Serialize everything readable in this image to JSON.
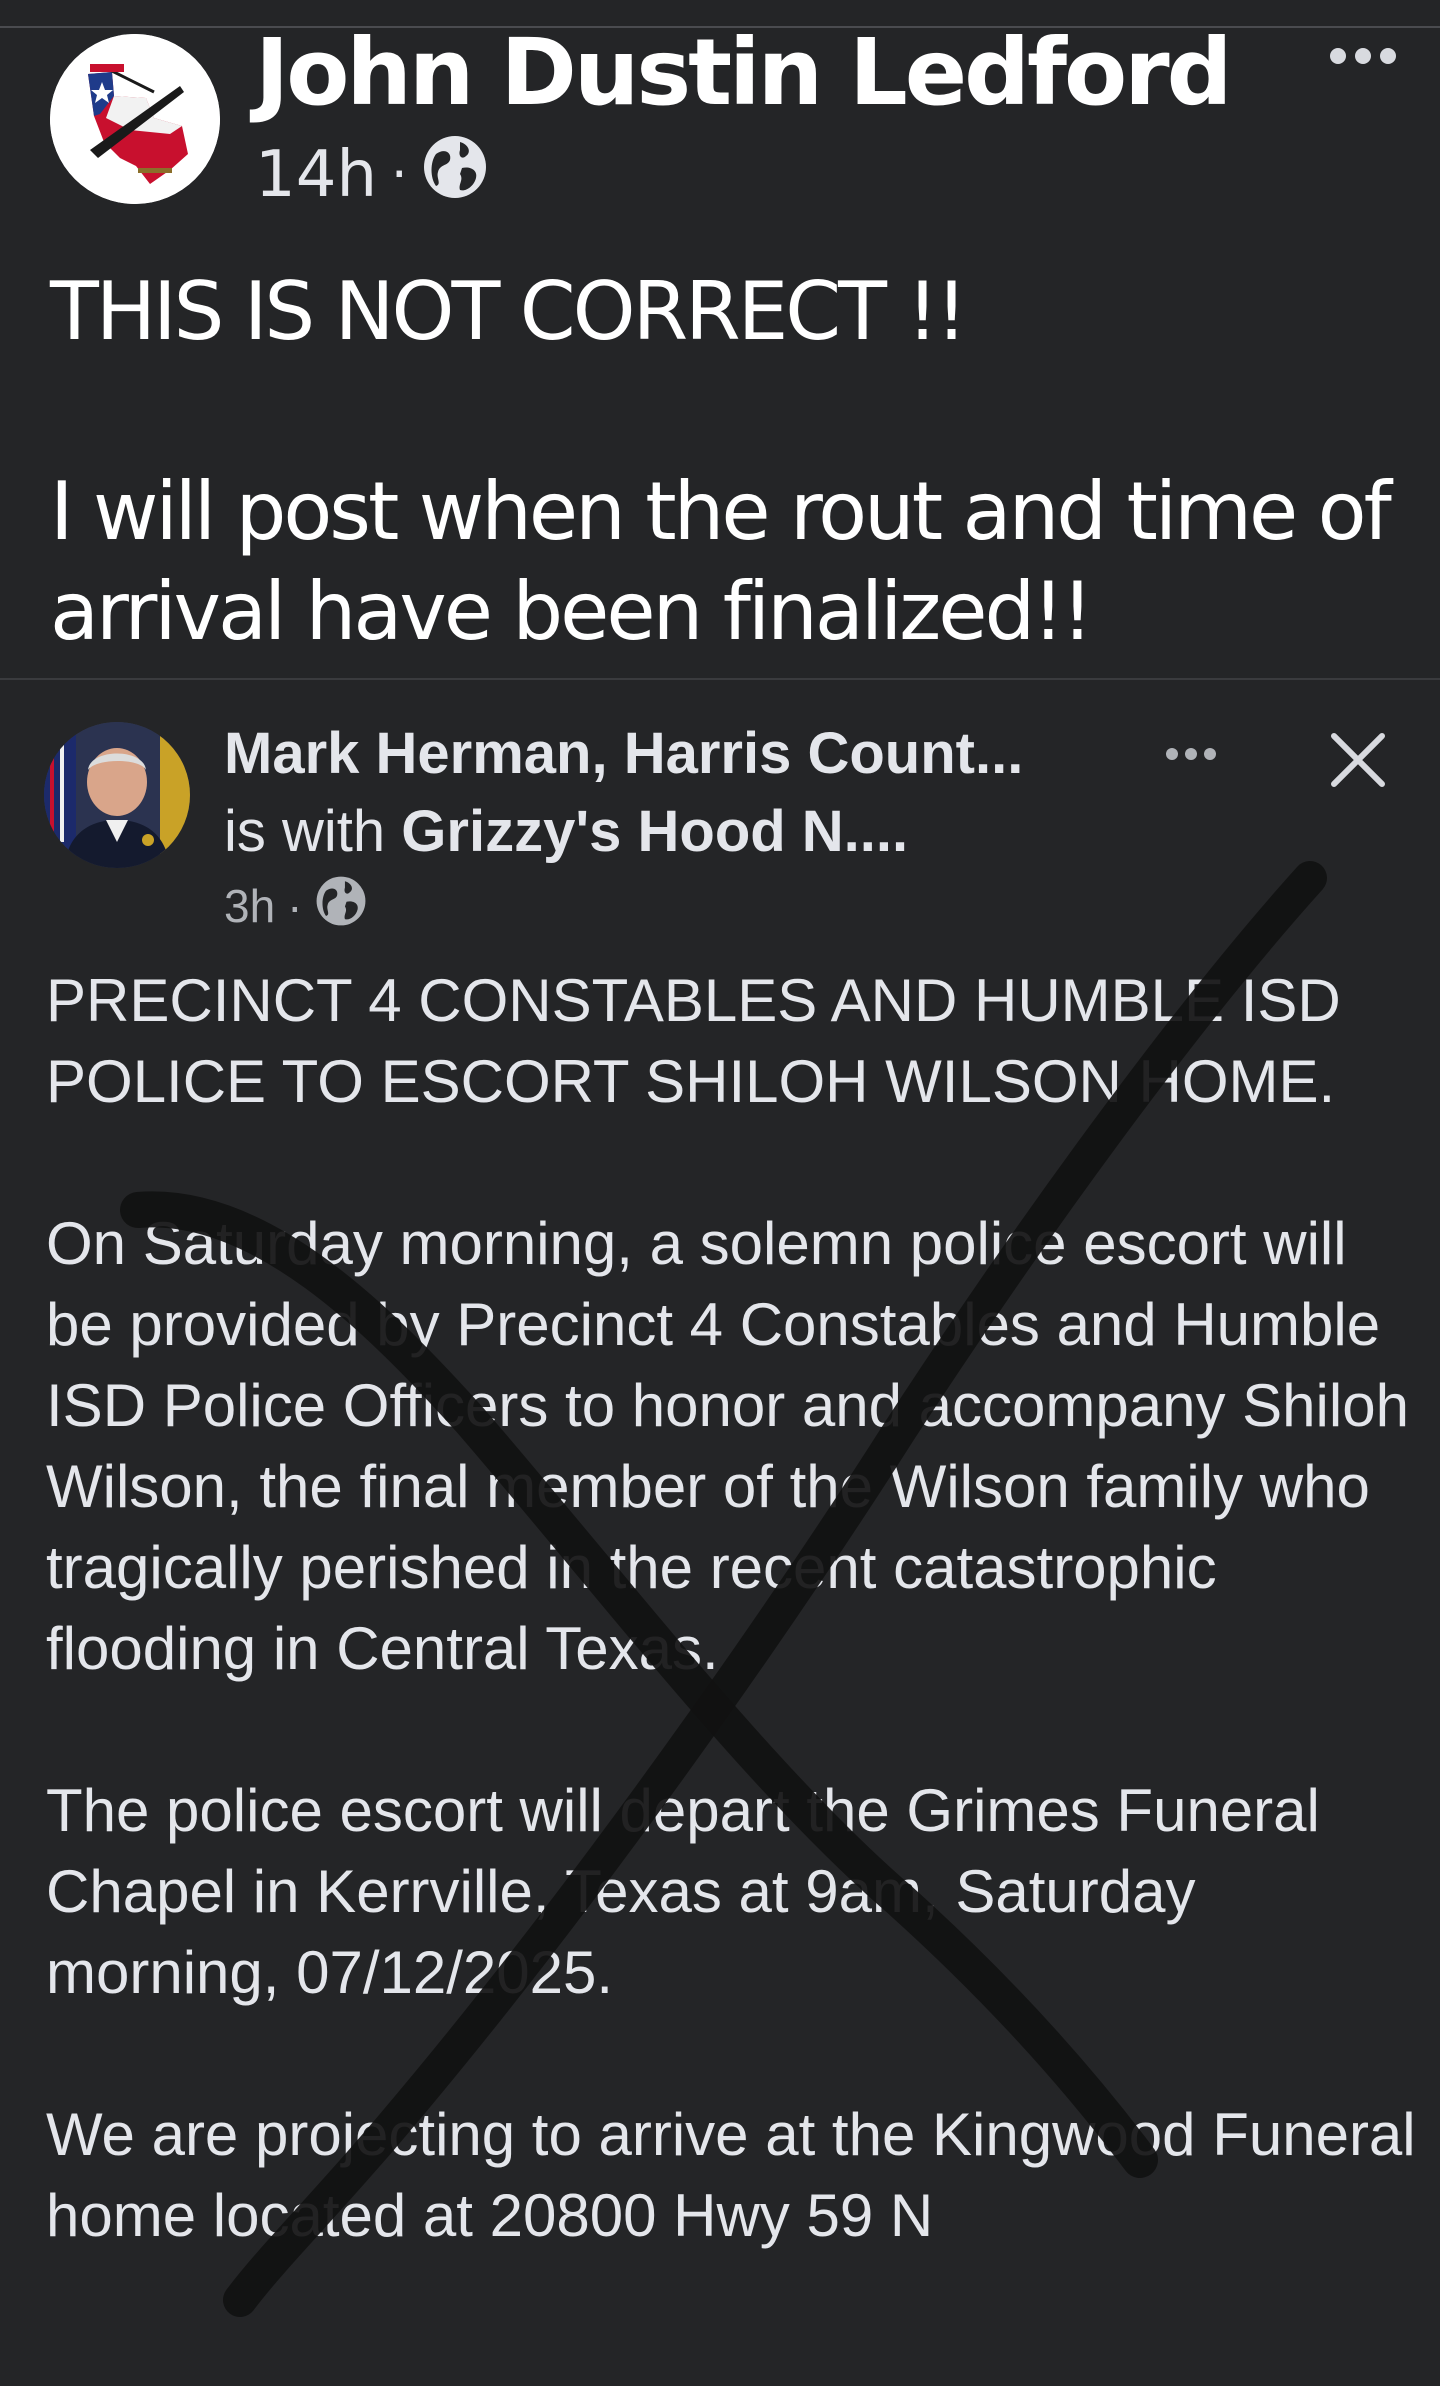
{
  "outer_post": {
    "author": "John Dustin Ledford",
    "time": "14h",
    "separator": "·",
    "paragraphs": [
      "THIS IS NOT CORRECT !!",
      "I will post when the rout and time of arrival have been finalized!!"
    ]
  },
  "inner_post": {
    "author": "Mark Herman, Harris Count...",
    "with_prefix": "is with",
    "with_page": "Grizzy's Hood N....",
    "time": "3h",
    "separator": "·",
    "paragraphs": [
      "PRECINCT 4 CONSTABLES AND HUMBLE ISD POLICE TO ESCORT SHILOH WILSON HOME.",
      "On Saturday morning, a solemn police escort will be provided by Precinct 4 Constables and Humble ISD Police Officers to honor and accompany Shiloh Wilson, the final member of the Wilson family who tragically perished in the recent catastrophic flooding in Central Texas.",
      "The police escort will depart the Grimes Funeral Chapel in Kerrville, Texas at 9am, Saturday morning, 07/12/2025.",
      "We are projecting to arrive at the Kingwood Funeral home located at 20800 Hwy 59 N"
    ]
  },
  "icons": {
    "privacy": "globe-icon",
    "more": "more-options-icon",
    "close": "close-icon"
  },
  "colors": {
    "background": "#242527",
    "text": "#e4e6eb",
    "muted": "#b0b3b8",
    "cross_mark": "#111111"
  }
}
